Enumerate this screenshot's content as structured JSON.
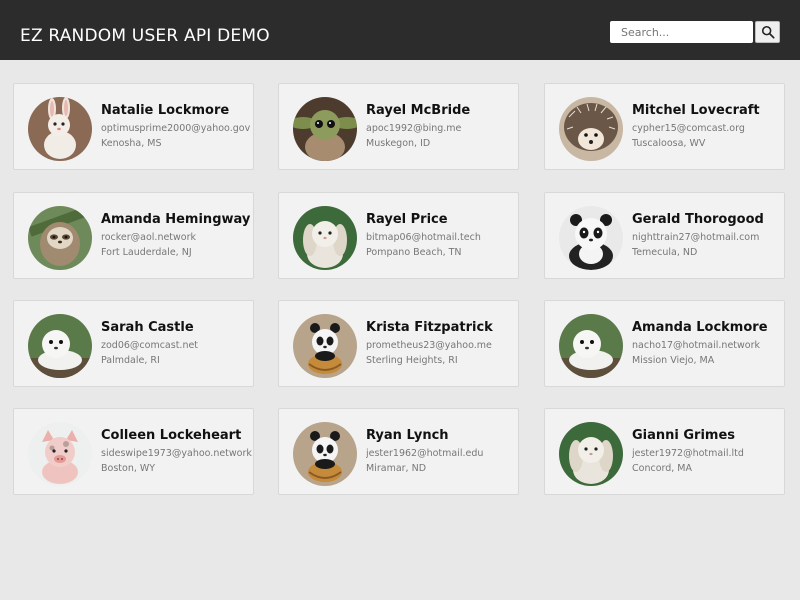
{
  "header": {
    "title": "EZ RANDOM USER API DEMO",
    "search_placeholder": "Search...",
    "search_icon": "search-icon"
  },
  "colors": {
    "header_bg": "#2c2c2c",
    "page_bg": "#e8e8e8",
    "card_bg": "#f2f2f2"
  },
  "users": [
    {
      "name": "Natalie Lockmore",
      "email": "optimusprime2000@yahoo.gov",
      "location": "Kenosha, MS",
      "avatar": "bunny"
    },
    {
      "name": "Rayel McBride",
      "email": "apoc1992@bing.me",
      "location": "Muskegon, ID",
      "avatar": "baby-yoda"
    },
    {
      "name": "Mitchel Lovecraft",
      "email": "cypher15@comcast.org",
      "location": "Tuscaloosa, WV",
      "avatar": "hedgehog"
    },
    {
      "name": "Amanda Hemingway",
      "email": "rocker@aol.network",
      "location": "Fort Lauderdale, NJ",
      "avatar": "sloth"
    },
    {
      "name": "Rayel Price",
      "email": "bitmap06@hotmail.tech",
      "location": "Pompano Beach, TN",
      "avatar": "lop-bunny"
    },
    {
      "name": "Gerald Thorogood",
      "email": "nighttrain27@hotmail.com",
      "location": "Temecula, ND",
      "avatar": "panda"
    },
    {
      "name": "Sarah Castle",
      "email": "zod06@comcast.net",
      "location": "Palmdale, RI",
      "avatar": "seal"
    },
    {
      "name": "Krista Fitzpatrick",
      "email": "prometheus23@yahoo.me",
      "location": "Sterling Heights, RI",
      "avatar": "panda-basket"
    },
    {
      "name": "Amanda Lockmore",
      "email": "nacho17@hotmail.network",
      "location": "Mission Viejo, MA",
      "avatar": "seal"
    },
    {
      "name": "Colleen Lockeheart",
      "email": "sideswipe1973@yahoo.network",
      "location": "Boston, WY",
      "avatar": "piglet"
    },
    {
      "name": "Ryan Lynch",
      "email": "jester1962@hotmail.edu",
      "location": "Miramar, ND",
      "avatar": "panda-basket"
    },
    {
      "name": "Gianni Grimes",
      "email": "jester1972@hotmail.ltd",
      "location": "Concord, MA",
      "avatar": "lop-bunny"
    }
  ]
}
